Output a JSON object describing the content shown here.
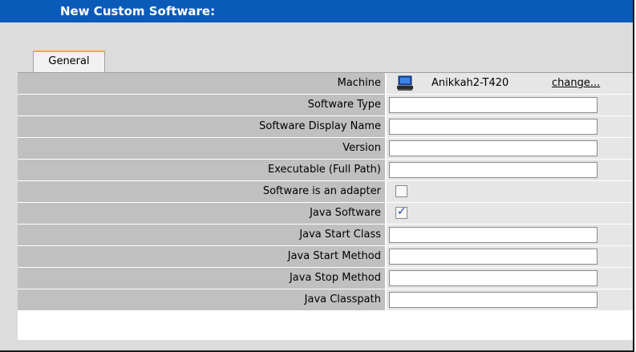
{
  "window": {
    "title": "New Custom Software:"
  },
  "tabs": [
    {
      "label": "General",
      "active": true
    }
  ],
  "form": {
    "machine": {
      "label": "Machine",
      "value": "Anikkah2-T420",
      "change_link": "change...",
      "icon": "computer-icon"
    },
    "fields": [
      {
        "label": "Software Type",
        "type": "text",
        "value": ""
      },
      {
        "label": "Software Display Name",
        "type": "text",
        "value": ""
      },
      {
        "label": "Version",
        "type": "text",
        "value": ""
      },
      {
        "label": "Executable (Full Path)",
        "type": "text",
        "value": ""
      },
      {
        "label": "Software is an adapter",
        "type": "checkbox",
        "checked": false
      },
      {
        "label": "Java Software",
        "type": "checkbox",
        "checked": true
      },
      {
        "label": "Java Start Class",
        "type": "text",
        "value": ""
      },
      {
        "label": "Java Start Method",
        "type": "text",
        "value": ""
      },
      {
        "label": "Java Stop Method",
        "type": "text",
        "value": ""
      },
      {
        "label": "Java Classpath",
        "type": "text",
        "value": ""
      }
    ]
  },
  "colors": {
    "title_bar": "#0a5ab8",
    "tab_accent": "#f0b400",
    "label_bg": "#c0c0c0"
  }
}
